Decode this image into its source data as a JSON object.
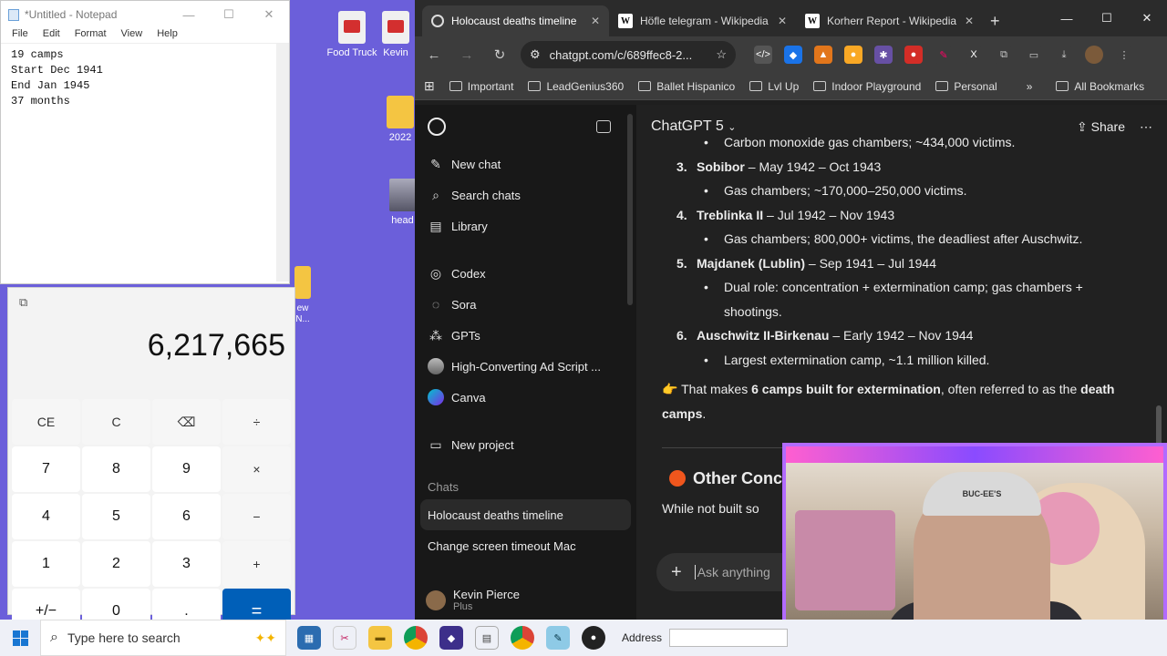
{
  "notepad": {
    "title": "*Untitled - Notepad",
    "menu": [
      "File",
      "Edit",
      "Format",
      "View",
      "Help"
    ],
    "lines": [
      "19 camps",
      "Start Dec 1941",
      "End Jan 1945",
      "37 months"
    ]
  },
  "calculator": {
    "display": "6,217,665",
    "keys": [
      "CE",
      "C",
      "⌫",
      "÷",
      "7",
      "8",
      "9",
      "×",
      "4",
      "5",
      "6",
      "−",
      "1",
      "2",
      "3",
      "+",
      "+/−",
      "0",
      ".",
      "="
    ]
  },
  "desktop": {
    "icons": [
      {
        "label": "Food Truck"
      },
      {
        "label": "Kevin"
      },
      {
        "label": "2022"
      },
      {
        "label": "head"
      },
      {
        "label": "ew\nN..."
      }
    ]
  },
  "browser": {
    "tabs": [
      {
        "label": "Holocaust deaths timeline",
        "icon": "chatgpt-icon",
        "active": true
      },
      {
        "label": "Höfle telegram - Wikipedia",
        "icon": "W"
      },
      {
        "label": "Korherr Report - Wikipedia",
        "icon": "W"
      }
    ],
    "url": "chatgpt.com/c/689ffec8-2...",
    "bookmarks": [
      "Important",
      "LeadGenius360",
      "Ballet Hispanico",
      "Lvl Up",
      "Indoor Playground",
      "Personal"
    ],
    "all_bookmarks": "All Bookmarks",
    "more": "»"
  },
  "sidebar": {
    "items": [
      {
        "label": "New chat",
        "icon": "✎"
      },
      {
        "label": "Search chats",
        "icon": "⌕"
      },
      {
        "label": "Library",
        "icon": "▤"
      }
    ],
    "items2": [
      {
        "label": "Codex",
        "icon": "◎"
      },
      {
        "label": "Sora",
        "icon": "◌"
      },
      {
        "label": "GPTs",
        "icon": "⁂"
      },
      {
        "label": "High-Converting Ad Script ...",
        "icon": ""
      },
      {
        "label": "Canva",
        "icon": ""
      }
    ],
    "new_project": "New project",
    "chats_header": "Chats",
    "chats": [
      "Holocaust deaths timeline",
      "Change screen timeout Mac"
    ],
    "user": {
      "name": "Kevin Pierce",
      "plan": "Plus"
    }
  },
  "main": {
    "model": "ChatGPT 5",
    "share": "Share",
    "top_sub": "Carbon monoxide gas chambers; ~434,000 victims.",
    "camps": [
      {
        "n": "3.",
        "name": "Sobibor",
        "dates": " – May 1942 – Oct 1943",
        "sub": "Gas chambers; ~170,000–250,000 victims."
      },
      {
        "n": "4.",
        "name": "Treblinka II",
        "dates": " – Jul 1942 – Nov 1943",
        "sub": "Gas chambers; 800,000+ victims, the deadliest after Auschwitz."
      },
      {
        "n": "5.",
        "name": "Majdanek (Lublin)",
        "dates": " – Sep 1941 – Jul 1944",
        "sub": "Dual role: concentration + extermination camp; gas chambers + shootings."
      },
      {
        "n": "6.",
        "name": "Auschwitz II-Birkenau",
        "dates": " – Early 1942 – Nov 1944",
        "sub": "Largest extermination camp, ~1.1 million killed."
      }
    ],
    "summary_pre": "👉 That makes ",
    "summary_bold": "6 camps built for extermination",
    "summary_post": ", often referred to as the ",
    "summary_bold2": "death camps",
    "summary_end": ".",
    "section_heading": "Other Conc",
    "section_text": "While not built so",
    "composer_placeholder": "Ask anything"
  },
  "webcam": {
    "hat_text": "BUC-EE'S"
  },
  "taskbar": {
    "search_placeholder": "Type here to search",
    "address_label": "Address"
  }
}
